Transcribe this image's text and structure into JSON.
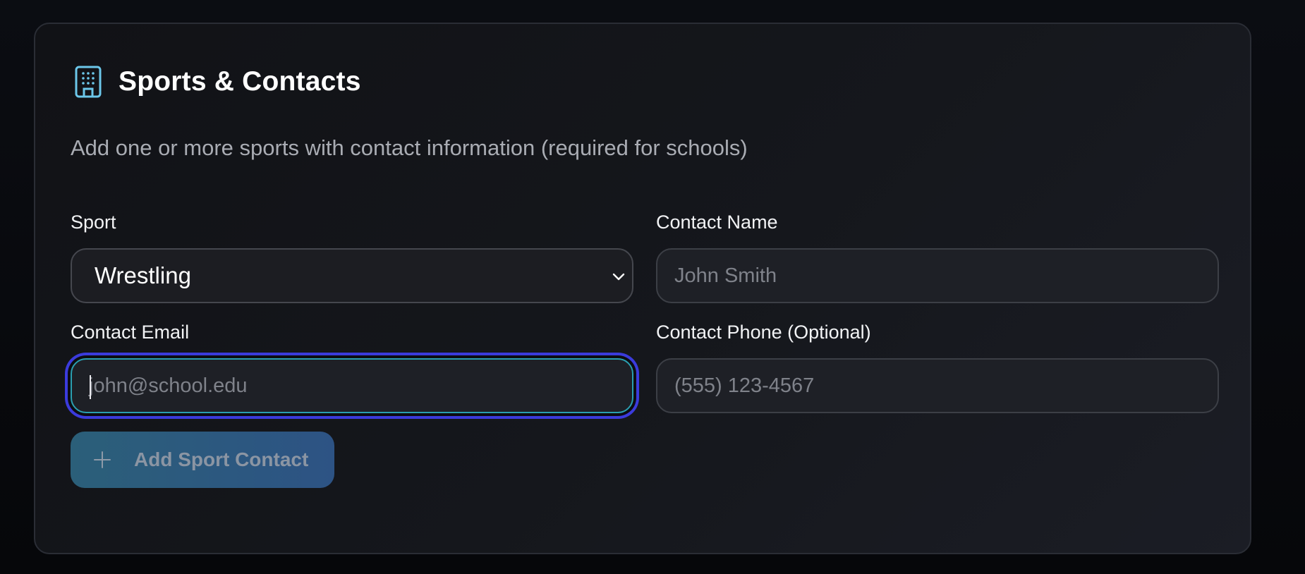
{
  "card": {
    "title": "Sports & Contacts",
    "icon": "building-icon",
    "subtitle": "Add one or more sports with contact information (required for schools)"
  },
  "fields": {
    "sport": {
      "label": "Sport",
      "value": "Wrestling"
    },
    "contact_name": {
      "label": "Contact Name",
      "placeholder": "John Smith",
      "value": ""
    },
    "contact_email": {
      "label": "Contact Email",
      "placeholder": "john@school.edu",
      "value": ""
    },
    "contact_phone": {
      "label": "Contact Phone (Optional)",
      "placeholder": "(555) 123-4567",
      "value": ""
    }
  },
  "actions": {
    "add_label": "Add Sport Contact",
    "add_icon": "plus-icon"
  },
  "colors": {
    "accent_icon": "#6cc7ea",
    "focus_ring": "#3b3bdc",
    "button_gradient_start": "#2b5f79",
    "button_gradient_end": "#2d5384"
  }
}
